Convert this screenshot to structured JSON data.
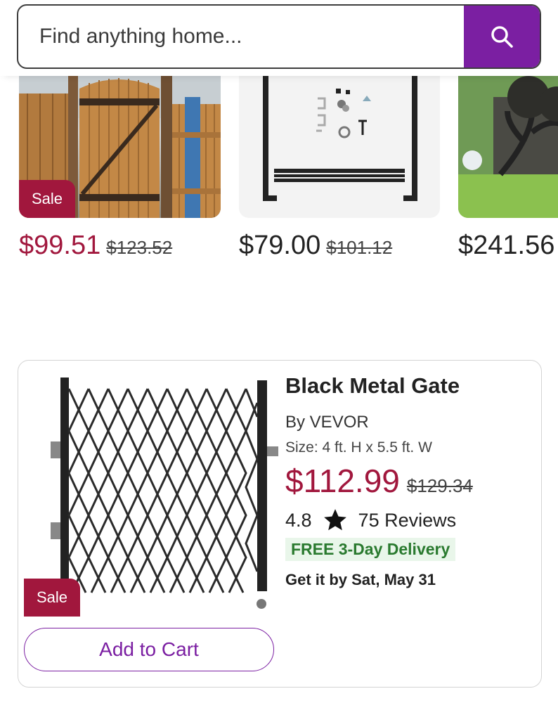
{
  "search": {
    "placeholder": "Find anything home..."
  },
  "carousel": {
    "items": [
      {
        "price": "$99.51",
        "was_price": "$123.52",
        "badge": "Sale"
      },
      {
        "price": "$79.00",
        "was_price": "$101.12"
      },
      {
        "price": "$241.56"
      }
    ]
  },
  "product": {
    "title": "Black Metal Gate",
    "brand": "By VEVOR",
    "size": "Size: 4 ft. H x 5.5 ft. W",
    "price": "$112.99",
    "was_price": "$129.34",
    "rating": "4.8",
    "reviews": "75 Reviews",
    "delivery": "FREE 3-Day Delivery",
    "arrival": "Get it by Sat, May 31",
    "badge": "Sale",
    "add_to_cart": "Add to Cart"
  },
  "colors": {
    "brand_purple": "#7b1fa2",
    "sale_red": "#a1173d",
    "delivery_green": "#2a7a2f"
  },
  "icons": {
    "search": "search-icon",
    "star": "star-icon"
  }
}
